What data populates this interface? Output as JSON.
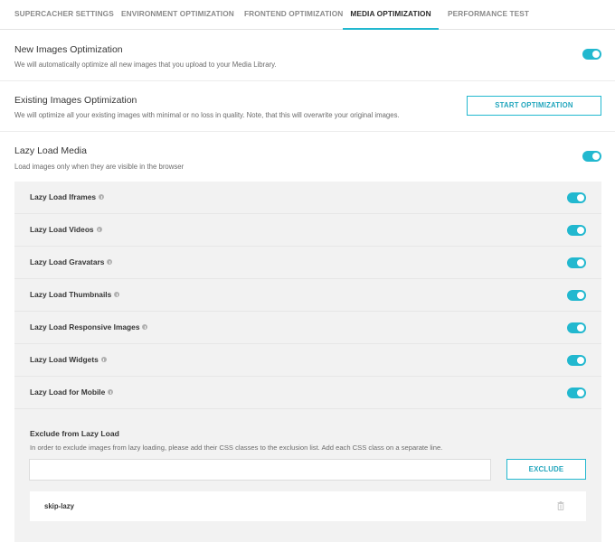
{
  "tabs": [
    {
      "label": "SUPERCACHER SETTINGS",
      "active": false
    },
    {
      "label": "ENVIRONMENT OPTIMIZATION",
      "active": false
    },
    {
      "label": "FRONTEND OPTIMIZATION",
      "active": false
    },
    {
      "label": "MEDIA OPTIMIZATION",
      "active": true
    },
    {
      "label": "PERFORMANCE TEST",
      "active": false
    }
  ],
  "new_images": {
    "title": "New Images Optimization",
    "description": "We will automatically optimize all new images that you upload to your Media Library.",
    "enabled": true
  },
  "existing_images": {
    "title": "Existing Images Optimization",
    "description": "We will optimize all your existing images with minimal or no loss in quality. Note, that this will overwrite your original images.",
    "button_label": "START OPTIMIZATION"
  },
  "lazy_load": {
    "title": "Lazy Load Media",
    "description": "Load images only when they are visible in the browser",
    "enabled": true,
    "options": [
      {
        "label": "Lazy Load Iframes",
        "enabled": true
      },
      {
        "label": "Lazy Load Videos",
        "enabled": true
      },
      {
        "label": "Lazy Load Gravatars",
        "enabled": true
      },
      {
        "label": "Lazy Load Thumbnails",
        "enabled": true
      },
      {
        "label": "Lazy Load Responsive Images",
        "enabled": true
      },
      {
        "label": "Lazy Load Widgets",
        "enabled": true
      },
      {
        "label": "Lazy Load for Mobile",
        "enabled": true
      }
    ]
  },
  "exclude": {
    "title": "Exclude from Lazy Load",
    "description": "In order to exclude images from lazy loading, please add their CSS classes to the exclusion list. Add each CSS class on a separate line.",
    "input_value": "",
    "input_placeholder": "",
    "button_label": "EXCLUDE",
    "classes": [
      "skip-lazy"
    ]
  },
  "colors": {
    "accent": "#22b8cf",
    "panel_bg": "#f2f2f2"
  }
}
